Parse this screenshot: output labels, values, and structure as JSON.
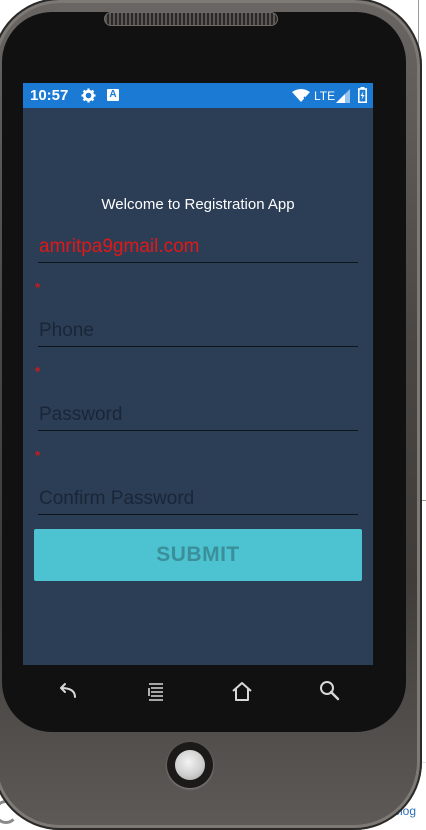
{
  "status_bar": {
    "time": "10:57",
    "network": "LTE",
    "icons": [
      "gear-icon",
      "a-icon",
      "wifi-icon",
      "signal-icon",
      "battery-icon"
    ],
    "color": "#1a7ad4"
  },
  "screen": {
    "background": "#2c3e55",
    "welcome_text": "Welcome to Registration App"
  },
  "form": {
    "email_value": "amritpa9gmail.com",
    "required_mark": "*",
    "phone_placeholder": "Phone",
    "password_placeholder": "Password",
    "confirm_password_placeholder": "Confirm Password",
    "submit_label": "SUBMIT",
    "submit_color": "#4dc3d1",
    "error_color": "#e01818"
  },
  "nav_bar": {
    "icons": [
      "back-icon",
      "menu-icon",
      "home-icon",
      "search-icon"
    ]
  },
  "background_page": {
    "footer_link_partial": "g",
    "footer_link_blog": "Blog"
  }
}
